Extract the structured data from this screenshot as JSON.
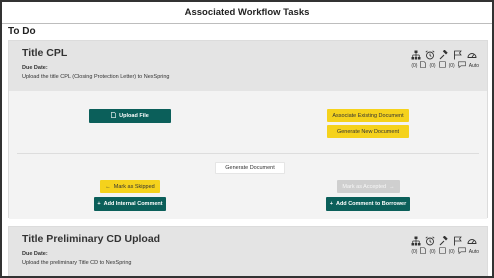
{
  "header": {
    "title": "Associated Workflow Tasks"
  },
  "section": {
    "title": "To Do"
  },
  "icons": [
    "sitemap-icon",
    "alarm-icon",
    "gavel-icon",
    "flag-icon",
    "gauge-icon"
  ],
  "tasks": [
    {
      "title": "Title CPL",
      "due_label": "Due Date:",
      "description": "Upload the title CPL (Closing Protection Letter) to NexSpring",
      "counts": {
        "docs": "(0)",
        "notes": "(0)",
        "comments": "(0)",
        "mode": "Auto"
      },
      "actions": {
        "upload": "Upload File",
        "associate": "Associate Existing Document",
        "generate_new": "Generate New Document",
        "generate": "Generate Document",
        "skip": "Mark as Skipped",
        "accept": "Mark as Accepted",
        "internal_comment": "Add Internal Comment",
        "borrower_comment": "Add Comment to Borrower"
      },
      "colors": {
        "teal": "#0b5f5a",
        "yellow": "#f5d21c",
        "disabled": "#cfcfcf"
      }
    },
    {
      "title": "Title Preliminary CD Upload",
      "due_label": "Due Date:",
      "description": "Upload the preliminary Title CD to NexSpring",
      "counts": {
        "docs": "(0)",
        "notes": "(0)",
        "comments": "(0)",
        "mode": "Auto"
      }
    }
  ]
}
